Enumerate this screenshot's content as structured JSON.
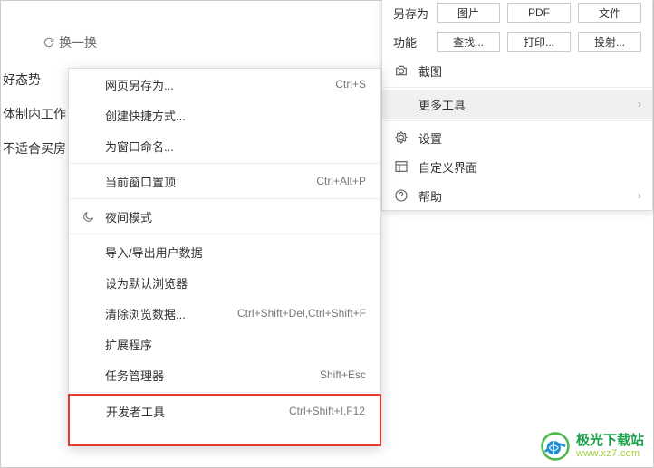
{
  "background": {
    "refresh": "换一换",
    "lines": [
      "好态势",
      "体制内工作",
      "不适合买房"
    ]
  },
  "main_menu": {
    "save_row": {
      "label": "另存为",
      "btn1": "图片",
      "btn2": "PDF",
      "btn3": "文件"
    },
    "func_row": {
      "label": "功能",
      "btn1": "查找...",
      "btn2": "打印...",
      "btn3": "投射..."
    },
    "screenshot": "截图",
    "more_tools": "更多工具",
    "settings": "设置",
    "custom_ui": "自定义界面",
    "help": "帮助"
  },
  "submenu": {
    "save_page": {
      "label": "网页另存为...",
      "shortcut": "Ctrl+S"
    },
    "create_shortcut": {
      "label": "创建快捷方式..."
    },
    "name_window": {
      "label": "为窗口命名..."
    },
    "pin_window": {
      "label": "当前窗口置顶",
      "shortcut": "Ctrl+Alt+P"
    },
    "night_mode": {
      "label": "夜间模式"
    },
    "import_export": {
      "label": "导入/导出用户数据"
    },
    "default_browser": {
      "label": "设为默认浏览器"
    },
    "clear_data": {
      "label": "清除浏览数据...",
      "shortcut": "Ctrl+Shift+Del,Ctrl+Shift+F"
    },
    "extensions": {
      "label": "扩展程序"
    },
    "task_manager": {
      "label": "任务管理器",
      "shortcut": "Shift+Esc"
    },
    "dev_tools": {
      "label": "开发者工具",
      "shortcut": "Ctrl+Shift+I,F12"
    }
  },
  "watermark": {
    "title": "极光下载站",
    "url": "www.xz7.com"
  }
}
